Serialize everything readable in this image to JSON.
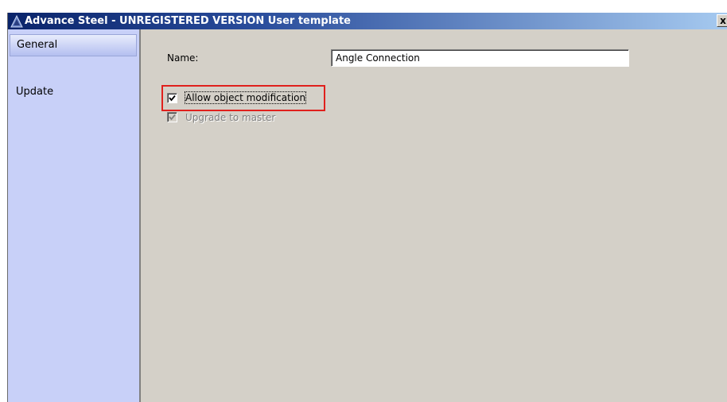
{
  "window": {
    "title": "Advance Steel - UNREGISTERED VERSION  User template",
    "close_label": "x"
  },
  "sidebar": {
    "items": [
      {
        "label": "General",
        "selected": true
      },
      {
        "label": "Update",
        "selected": false
      }
    ]
  },
  "form": {
    "name_label": "Name:",
    "name_value": "Angle Connection",
    "allow_modification_label": "Allow object modification",
    "allow_modification_checked": true,
    "upgrade_master_label": "Upgrade to master",
    "upgrade_master_checked": true,
    "upgrade_master_enabled": false
  },
  "colors": {
    "titlebar_start": "#0a246a",
    "titlebar_end": "#a6caf0",
    "sidebar_bg": "#c8d0f8",
    "dialog_bg": "#d4d0c8",
    "highlight": "#e0201c"
  },
  "icons": {
    "app": "advance-steel-logo-icon",
    "close": "close-icon",
    "check": "checkmark-icon"
  }
}
